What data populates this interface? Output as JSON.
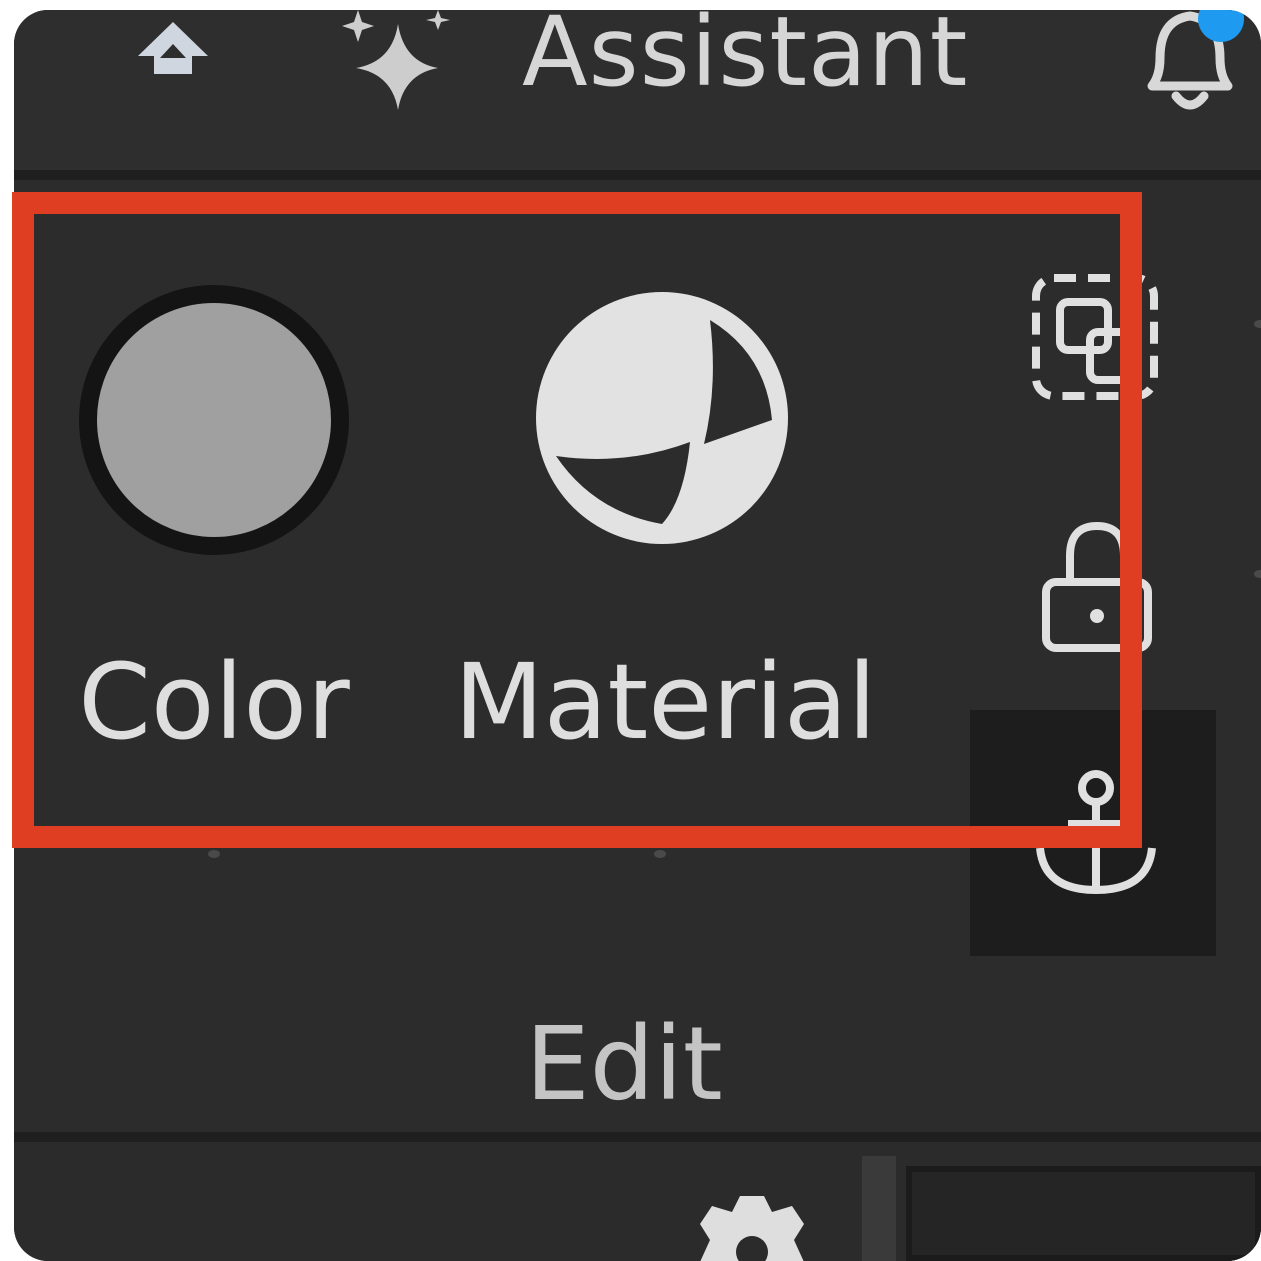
{
  "topbar": {
    "assistant_label": "Assistant",
    "icons": [
      "home-icon",
      "sparkle-icon",
      "bell-icon"
    ],
    "notification_dot_color": "#1e9bf0"
  },
  "tools": {
    "color": {
      "label": "Color",
      "swatch_color": "#a0a0a0"
    },
    "material": {
      "label": "Material"
    },
    "side_icons": [
      "group-icon",
      "lock-icon",
      "anchor-icon"
    ]
  },
  "group": {
    "label": "Edit"
  },
  "highlight": {
    "color": "#e03e22"
  },
  "bottom": {
    "icons": [
      "gear-icon"
    ]
  }
}
